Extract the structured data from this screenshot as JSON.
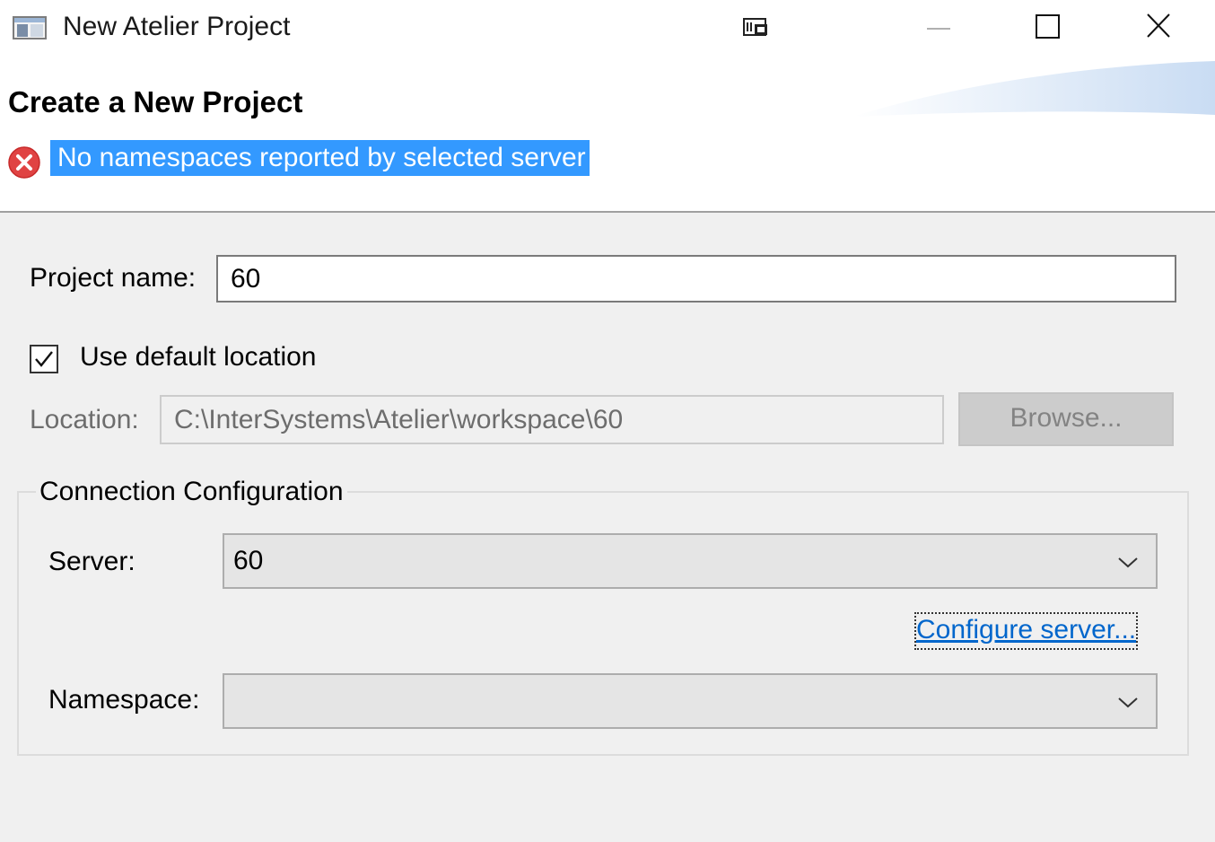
{
  "window": {
    "title": "New Atelier Project",
    "icons": {
      "app": "window-app-icon",
      "restore_layout": "restore-layout-icon",
      "minimize": "minimize-icon",
      "maximize": "maximize-icon",
      "close": "close-icon"
    }
  },
  "header": {
    "heading": "Create a New Project",
    "error_message": "No namespaces reported by selected server",
    "error_icon": "error-x-icon",
    "error_color": "#e04343",
    "selection_color": "#3399ff"
  },
  "form": {
    "project_name": {
      "label": "Project name:",
      "value": "60"
    },
    "use_default_location": {
      "label": "Use default location",
      "checked": true
    },
    "location": {
      "label": "Location:",
      "value": "C:\\InterSystems\\Atelier\\workspace\\60",
      "enabled": false
    },
    "browse_button": {
      "label": "Browse...",
      "enabled": false
    },
    "connection": {
      "title": "Connection Configuration",
      "server": {
        "label": "Server:",
        "value": "60"
      },
      "configure_link": "Configure server...",
      "namespace": {
        "label": "Namespace:",
        "value": ""
      }
    }
  },
  "colors": {
    "window_bg": "#f0f0f0",
    "link": "#0066cc"
  }
}
